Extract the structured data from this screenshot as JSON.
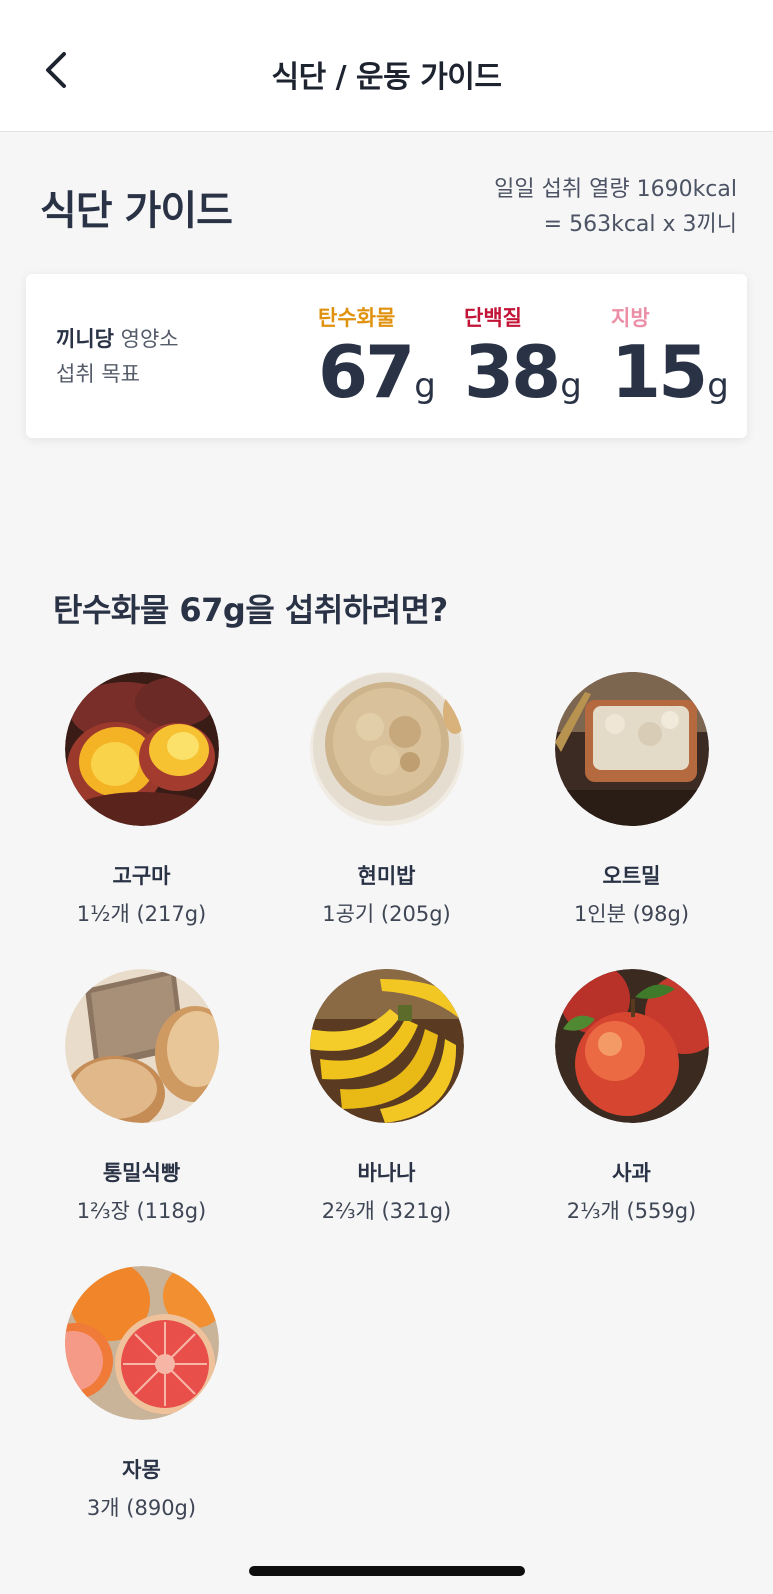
{
  "header": {
    "title": "식단 / 운동 가이드",
    "back_icon": "chevron-left-icon"
  },
  "diet_guide": {
    "title": "식단 가이드",
    "daily_calories_line": "일일 섭취 열량 1690kcal",
    "per_meal_line": "= 563kcal x 3끼니"
  },
  "target_card": {
    "label_bold": "끼니당",
    "label_rest": " 영양소",
    "label_line2": "섭취 목표",
    "nutrients": [
      {
        "name": "탄수화물",
        "value": "67",
        "unit": "g",
        "color": "#e0920f"
      },
      {
        "name": "단백질",
        "value": "38",
        "unit": "g",
        "color": "#c21436"
      },
      {
        "name": "지방",
        "value": "15",
        "unit": "g",
        "color": "#eb8fa6"
      }
    ]
  },
  "question": "탄수화물 67g을 섭취하려면?",
  "foods": [
    {
      "name": "고구마",
      "amount": "1½개 (217g)",
      "image": "sweet-potato-image"
    },
    {
      "name": "현미밥",
      "amount": "1공기 (205g)",
      "image": "brown-rice-image"
    },
    {
      "name": "오트밀",
      "amount": "1인분 (98g)",
      "image": "oatmeal-image"
    },
    {
      "name": "통밀식빵",
      "amount": "1⅔장 (118g)",
      "image": "whole-wheat-bread-image"
    },
    {
      "name": "바나나",
      "amount": "2⅔개 (321g)",
      "image": "banana-image"
    },
    {
      "name": "사과",
      "amount": "2⅓개 (559g)",
      "image": "apple-image"
    },
    {
      "name": "자몽",
      "amount": "3개 (890g)",
      "image": "grapefruit-image"
    }
  ]
}
